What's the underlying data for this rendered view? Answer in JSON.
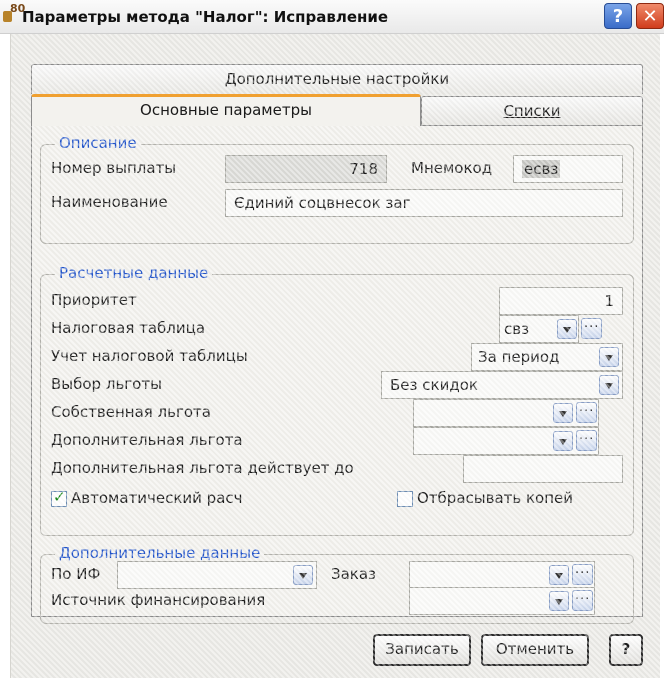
{
  "window": {
    "icon_badge": "80",
    "title": "Параметры метода \"Налог\": Исправление",
    "help_glyph": "?",
    "close_glyph": "✕"
  },
  "tabs": {
    "additional": "Дополнительные настройки",
    "main": "Основные параметры",
    "lists": "Списки"
  },
  "description": {
    "caption": "Описание",
    "payment_number_label": "Номер выплаты",
    "payment_number_value": "718",
    "mnemocode_label": "Мнемокод",
    "mnemocode_value": "есвз",
    "name_label": "Наименование",
    "name_value": "Єдиний соцвнесок заг"
  },
  "calc": {
    "caption": "Расчетные данные",
    "priority_label": "Приоритет",
    "priority_value": "1",
    "tax_table_label": "Налоговая таблица",
    "tax_table_value": "свз",
    "tax_table_accounting_label": "Учет налоговой таблицы",
    "tax_table_accounting_value": "За период",
    "benefit_choice_label": "Выбор льготы",
    "benefit_choice_value": "Без скидок",
    "own_benefit_label": "Собственная льгота",
    "own_benefit_value": "",
    "extra_benefit_label": "Дополнительная льгота",
    "extra_benefit_value": "",
    "extra_benefit_until_label": "Дополнительная льгота действует до",
    "extra_benefit_until_value": "",
    "auto_calc_label": "Автоматический расч",
    "auto_calc_checked": true,
    "discard_copies_label": "Отбрасывать копей",
    "discard_copies_checked": false
  },
  "extra": {
    "caption": "Дополнительные данные",
    "by_if_label": "По ИФ",
    "by_if_value": "",
    "order_label": "Заказ",
    "order_value": "",
    "funding_source_label": "Источник финансирования",
    "funding_source_value": ""
  },
  "buttons": {
    "save": "Записать",
    "cancel": "Отменить",
    "help": "?"
  }
}
